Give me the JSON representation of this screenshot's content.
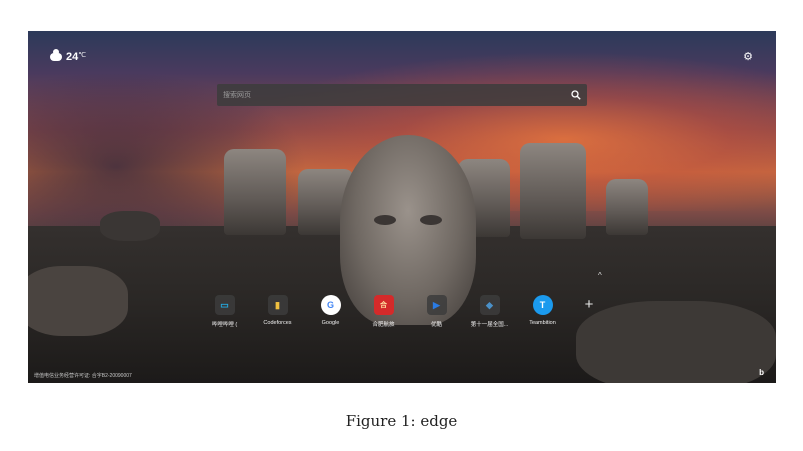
{
  "weather": {
    "icon": "cloud-icon",
    "temperature": "24",
    "unit": "℃"
  },
  "settings": {
    "icon": "gear-icon"
  },
  "search": {
    "placeholder": "搜索网页",
    "icon": "search-icon"
  },
  "collapse": {
    "icon": "chevron-up-icon",
    "glyph": "^"
  },
  "quick_links": [
    {
      "label": "哔哩哔哩 (",
      "icon": "bilibili-icon",
      "glyph": "▭",
      "color": "#23ade5"
    },
    {
      "label": "Codeforces",
      "icon": "codeforces-icon",
      "glyph": "▮",
      "color": "#f0c040"
    },
    {
      "label": "Google",
      "icon": "google-icon",
      "glyph": "G",
      "color": "#4285f4"
    },
    {
      "label": "合肥航旅",
      "icon": "hefei-icon",
      "glyph": "合",
      "color": "#d42a2a"
    },
    {
      "label": "优酷",
      "icon": "youku-icon",
      "glyph": "▶",
      "color": "#2a7be4"
    },
    {
      "label": "第十一届全国...",
      "icon": "site-icon",
      "glyph": "◆",
      "color": "#4a90c8"
    },
    {
      "label": "Teambition",
      "icon": "teambition-icon",
      "glyph": "T",
      "color": "#1b9aee"
    }
  ],
  "add_link": {
    "icon": "plus-icon",
    "glyph": "+"
  },
  "footer": {
    "text": "增值电信业务经营许可证: 合字B2-20090007"
  },
  "bing": {
    "icon": "bing-icon",
    "glyph": "b"
  },
  "caption": "Figure 1: edge"
}
